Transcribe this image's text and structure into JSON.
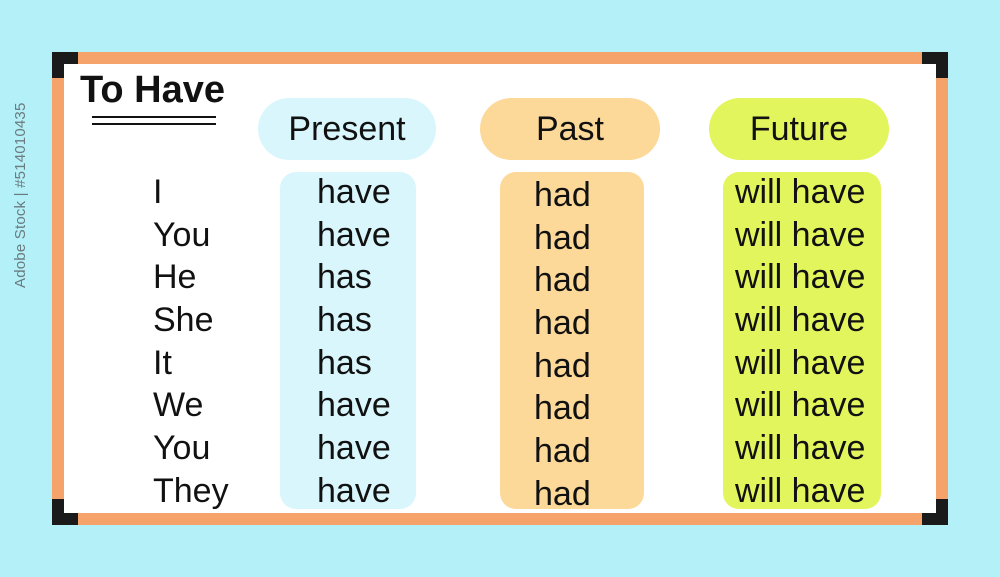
{
  "title": "To Have",
  "headers": {
    "present": "Present",
    "past": "Past",
    "future": "Future"
  },
  "pronouns": [
    "I",
    "You",
    "He",
    "She",
    "It",
    "We",
    "You",
    "They"
  ],
  "present": [
    "have",
    "have",
    "has",
    "has",
    "has",
    "have",
    "have",
    "have"
  ],
  "past": [
    "had",
    "had",
    "had",
    "had",
    "had",
    "had",
    "had",
    "had"
  ],
  "future": [
    "will have",
    "will have",
    "will have",
    "will have",
    "will have",
    "will have",
    "will have",
    "will have"
  ],
  "watermark": "Adobe Stock | #514010435",
  "colors": {
    "background": "#b3f0f7",
    "frame": "#f5a36a",
    "present": "#d9f6fd",
    "past": "#fcd999",
    "future": "#e3f55c"
  }
}
